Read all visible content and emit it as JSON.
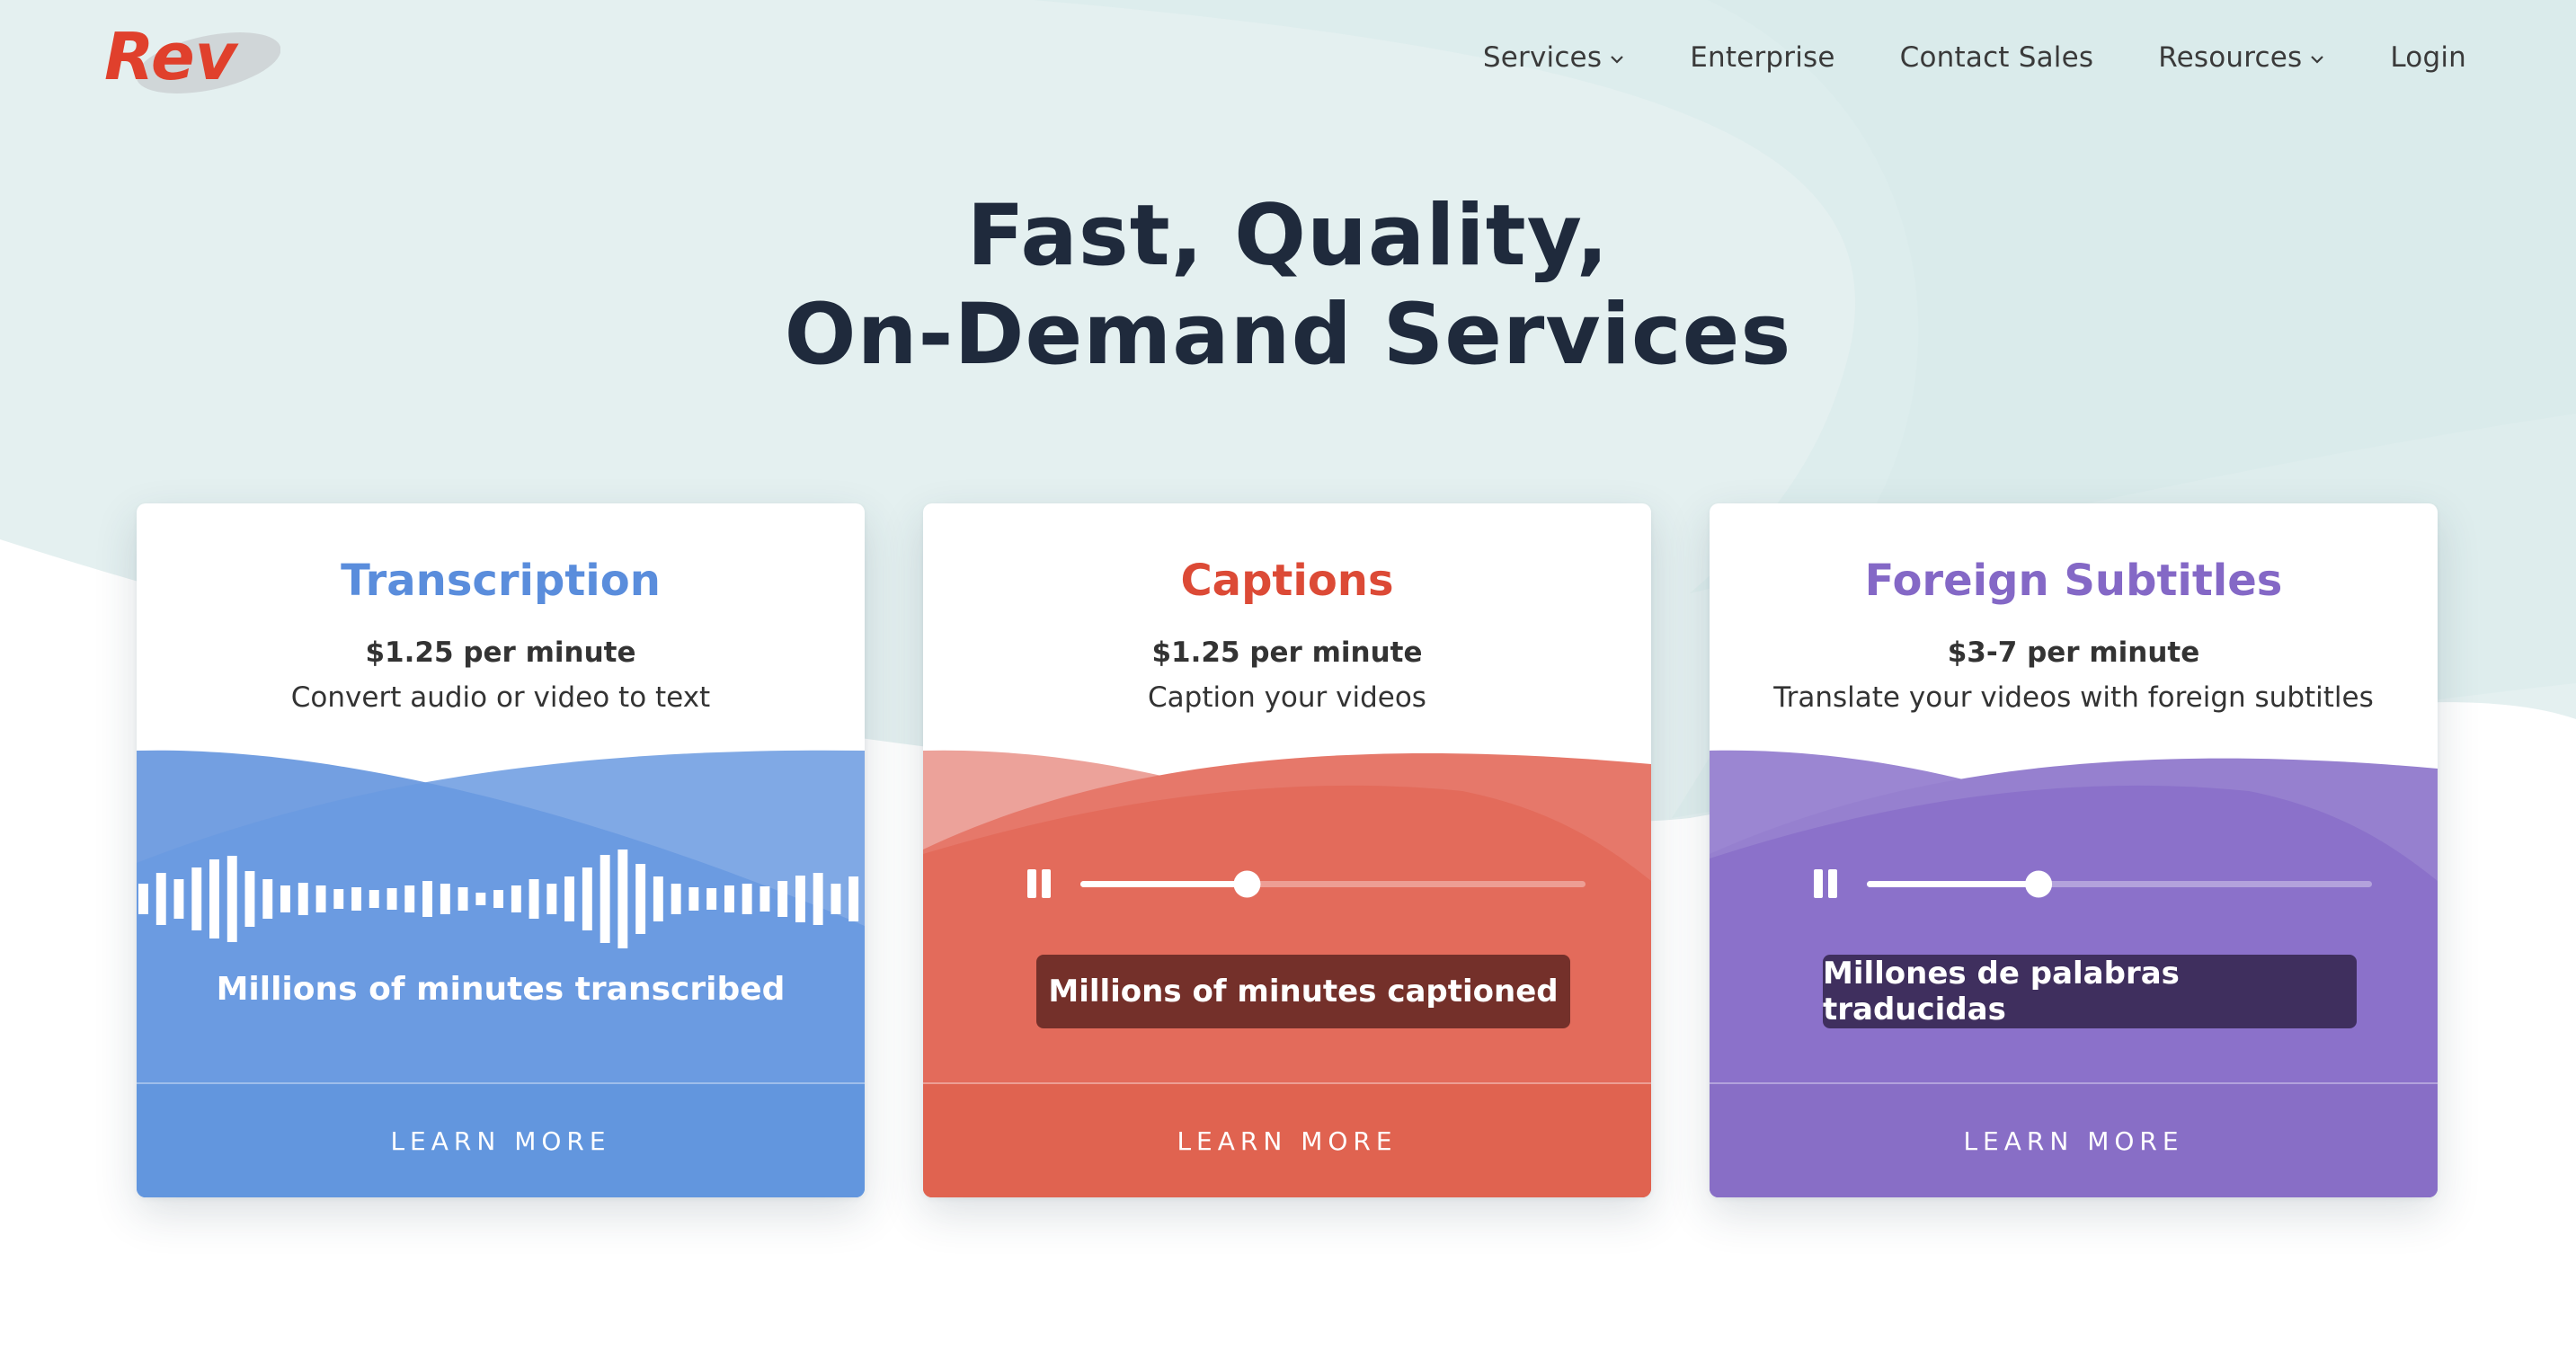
{
  "brand": {
    "logo_text": "Rev"
  },
  "nav": {
    "items": [
      {
        "label": "Services",
        "has_dropdown": true
      },
      {
        "label": "Enterprise",
        "has_dropdown": false
      },
      {
        "label": "Contact Sales",
        "has_dropdown": false
      },
      {
        "label": "Resources",
        "has_dropdown": true
      },
      {
        "label": "Login",
        "has_dropdown": false
      }
    ]
  },
  "hero": {
    "line1": "Fast, Quality,",
    "line2": "On-Demand Services"
  },
  "cards": [
    {
      "title": "Transcription",
      "price": "$1.25 per minute",
      "description": "Convert audio or video to text",
      "stat": "Millions of minutes transcribed",
      "cta": "LEARN MORE",
      "title_color": "#5a8ddc",
      "accent": "#6296de"
    },
    {
      "title": "Captions",
      "price": "$1.25 per minute",
      "description": "Caption your videos",
      "stat": "Millions of minutes captioned",
      "cta": "LEARN MORE",
      "title_color": "#dc4a36",
      "accent": "#e06350",
      "player_progress": 0.33
    },
    {
      "title": "Foreign Subtitles",
      "price": "$3-7 per minute",
      "description": "Translate your videos with foreign subtitles",
      "stat": "Millones de palabras traducidas",
      "cta": "LEARN MORE",
      "title_color": "#8468c6",
      "accent": "#886ec6",
      "player_progress": 0.34
    }
  ],
  "colors": {
    "hero_bg": "#e4f0f0",
    "heading": "#1f2a3c",
    "logo_red": "#e0402c"
  }
}
